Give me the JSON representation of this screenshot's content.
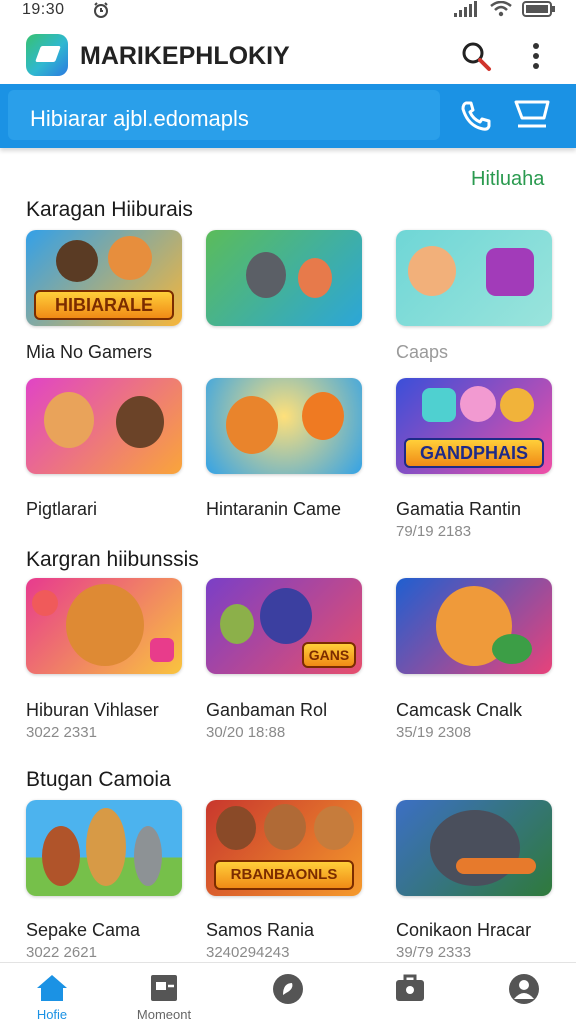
{
  "status_bar": {
    "time": "19:30"
  },
  "app_bar": {
    "title": "MARIKEPHLOKIY"
  },
  "search": {
    "value": "Hibiarar ajbl.edomapls"
  },
  "see_all_label": "Hitluaha",
  "sections": [
    {
      "title": "Karagan Hiiburais"
    },
    {
      "title": "Kargran hiibunssis"
    },
    {
      "title": "Btugan Camoia"
    }
  ],
  "row1": {
    "cards": [
      {
        "label": "Mia No Gamers",
        "banner": "HIBIARALE",
        "colors": [
          "#33a0e8",
          "#f7b63a"
        ]
      },
      {
        "label": "",
        "banner": "",
        "colors": [
          "#5bbc5a",
          "#2ca6d8"
        ]
      },
      {
        "label": "Caaps",
        "banner": "",
        "colors": [
          "#6fd6d6",
          "#9ae4dc"
        ]
      }
    ]
  },
  "row2": {
    "cards": [
      {
        "label": "Pigtlarari",
        "sub": "",
        "colors": [
          "#e044c6",
          "#f9a53a"
        ]
      },
      {
        "label": "Hintaranin Came",
        "sub": "",
        "colors": [
          "#33a2e6",
          "#f7c649"
        ]
      },
      {
        "label": "Gamatia Rantin",
        "sub": "79/19 2183",
        "banner": "GANDPHAIS",
        "colors": [
          "#3a4fd9",
          "#f04fa6"
        ]
      }
    ]
  },
  "row3": {
    "cards": [
      {
        "label": "Hiburan Vihlaser",
        "sub": "3022 2331",
        "colors": [
          "#e73a8f",
          "#f9c43e"
        ]
      },
      {
        "label": "Ganbaman Rol",
        "sub": "30/20 18:88",
        "banner": "GANS",
        "colors": [
          "#7a3fc7",
          "#e64f6d"
        ]
      },
      {
        "label": "Camcask Cnalk",
        "sub": "35/19 2308",
        "colors": [
          "#1f5fd0",
          "#e8427a"
        ]
      }
    ]
  },
  "row4": {
    "cards": [
      {
        "label": "Sepake Cama",
        "sub": "3022 2621",
        "colors": [
          "#4cb3ee",
          "#76c04a"
        ]
      },
      {
        "label": "Samos Rania",
        "sub": "3240294243",
        "banner": "RBANBAONLS",
        "colors": [
          "#c8372d",
          "#f59a2c"
        ]
      },
      {
        "label": "Conikaon Hracar",
        "sub": "39/79 2333",
        "colors": [
          "#3c6fc4",
          "#2f7a3b"
        ]
      }
    ]
  },
  "bottom_nav": [
    {
      "label": "Hofie",
      "icon": "home-icon",
      "active": true
    },
    {
      "label": "Momeont",
      "icon": "calendar-icon",
      "active": false
    },
    {
      "label": "",
      "icon": "chat-icon",
      "active": false
    },
    {
      "label": "",
      "icon": "bag-icon",
      "active": false
    },
    {
      "label": "",
      "icon": "profile-icon",
      "active": false
    }
  ],
  "colors": {
    "accent": "#1b92e4",
    "see_all": "#2a9a4f"
  }
}
